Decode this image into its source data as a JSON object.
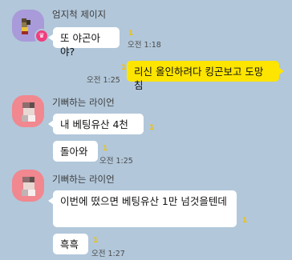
{
  "messages": [
    {
      "sender": "엄지척 제이지",
      "text": "또 야곤아야?",
      "unread": "1",
      "time": "오전 1:18"
    },
    {
      "sender": "",
      "text": "리신 올인하려다 킹곤보고 도망침",
      "unread": "1",
      "time": "오전 1:25"
    },
    {
      "sender": "기뻐하는 라이언",
      "text": "내 베팅유산 4천",
      "unread": "1",
      "time": ""
    },
    {
      "sender": "",
      "text": "돌아와",
      "unread": "1",
      "time": "오전 1:25"
    },
    {
      "sender": "기뻐하는 라이언",
      "text": "이번에 떴으면 베팅유산 1만 넘것을텐데",
      "unread": "1",
      "time": ""
    },
    {
      "sender": "",
      "text": "흑흑",
      "unread": "1",
      "time": "오전 1:27"
    }
  ],
  "colors": {
    "background": "#b2c7da",
    "my_bubble": "#fee500",
    "other_bubble": "#ffffff",
    "unread": "#f2c100"
  },
  "icons": {
    "host_badge": "crown-icon"
  }
}
